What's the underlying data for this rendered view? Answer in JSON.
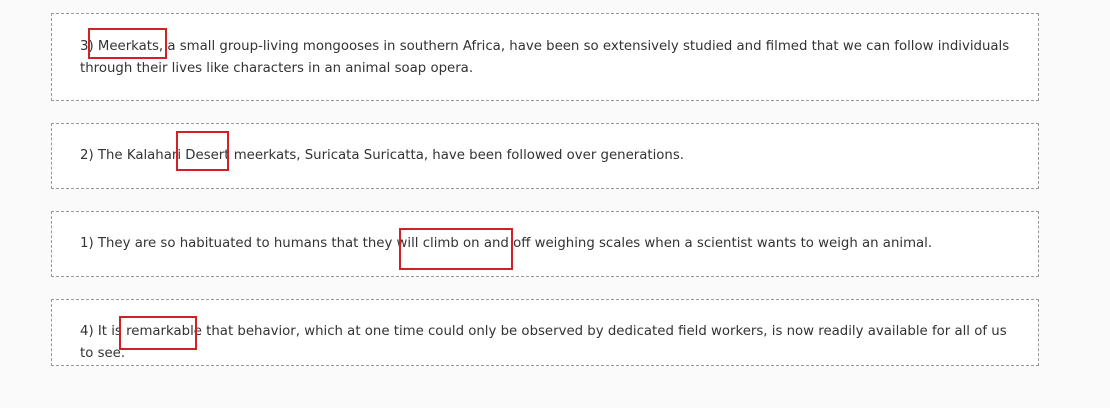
{
  "sentences": [
    {
      "id": "c1",
      "text": "3) Meerkats, a small group-living mongooses in southern Africa, have been so extensively studied and filmed that we can follow individuals through their lives like characters in an animal soap opera.",
      "highlight": "Meerkats,"
    },
    {
      "id": "c2",
      "text": "2) The Kalahari Desert meerkats, Suricata Suricatta, have been followed over generations.",
      "highlight": "Desert"
    },
    {
      "id": "c3",
      "text": "1) They are so habituated to humans that they will climb on and off weighing scales when a scientist wants to weigh an animal.",
      "highlight": "climb on and off"
    },
    {
      "id": "c4",
      "text": "4) It is remarkable that behavior, which at one time could only be observed by dedicated field workers, is now readily available for all of us to see.",
      "highlight": "remarkable"
    }
  ],
  "colors": {
    "highlight_border": "#d32027",
    "card_border": "#9a9a9a",
    "background": "#fafafa"
  }
}
